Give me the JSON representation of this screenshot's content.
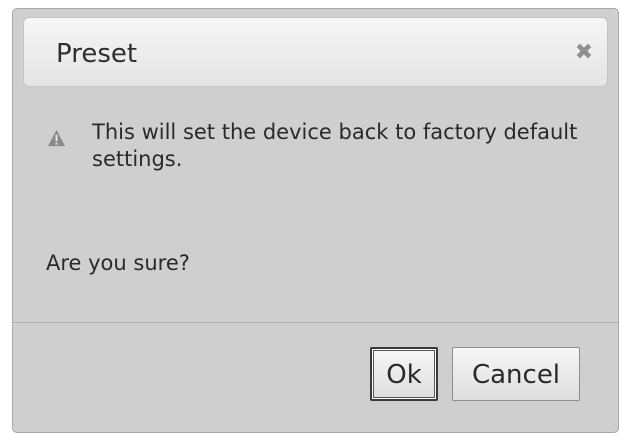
{
  "dialog": {
    "title": "Preset",
    "close_icon": "close-icon",
    "warning_icon": "warning-icon",
    "message": "This will set the device back to factory default settings.",
    "question": "Are you sure?",
    "buttons": {
      "ok_label": "Ok",
      "cancel_label": "Cancel"
    }
  }
}
